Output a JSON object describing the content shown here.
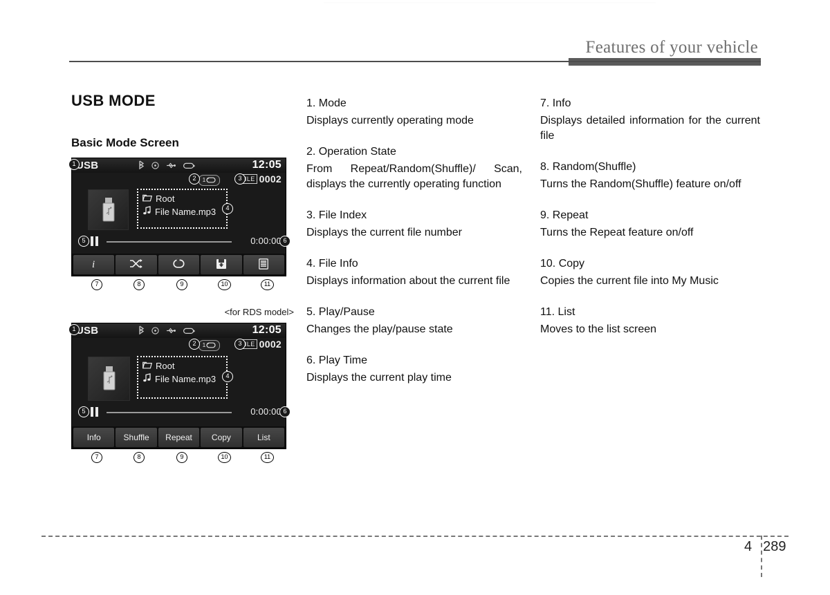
{
  "header": {
    "title": "Features of your vehicle"
  },
  "footer": {
    "chapter": "4",
    "page": "289"
  },
  "left": {
    "section_title": "USB MODE",
    "subsection_title": "Basic Mode Screen",
    "rds_caption": "<for RDS model>"
  },
  "screen": {
    "mode": "USB",
    "clock": "12:05",
    "status_icons": [
      "bluetooth-icon",
      "disc-icon",
      "usb-icon",
      "battery-icon"
    ],
    "op_state_badge": {
      "number": "1",
      "icon": "repeat-icon"
    },
    "file_index": {
      "tag": "FILE",
      "number": "0002"
    },
    "file_info": {
      "folder": "Root",
      "file": "File Name.mp3"
    },
    "play_state_icon": "pause-icon",
    "play_time": "0:00:00",
    "buttons_icons": [
      {
        "name": "info-icon",
        "glyph": "i"
      },
      {
        "name": "shuffle-icon",
        "glyph": ""
      },
      {
        "name": "repeat-icon",
        "glyph": ""
      },
      {
        "name": "copy-icon",
        "glyph": ""
      },
      {
        "name": "list-icon",
        "glyph": ""
      }
    ],
    "buttons_labels": [
      "Info",
      "Shuffle",
      "Repeat",
      "Copy",
      "List"
    ],
    "callouts": [
      "1",
      "2",
      "3",
      "4",
      "5",
      "6",
      "7",
      "8",
      "9",
      "10",
      "11"
    ]
  },
  "middle_column": [
    {
      "title": "1. Mode",
      "desc": "Displays currently operating mode"
    },
    {
      "title": "2. Operation State",
      "desc": "From Repeat/Random(Shuffle)/ Scan, displays the currently operating function"
    },
    {
      "title": "3. File Index",
      "desc": "Displays the current file number"
    },
    {
      "title": "4. File Info",
      "desc": "Displays information about the current file"
    },
    {
      "title": "5. Play/Pause",
      "desc": "Changes the play/pause state"
    },
    {
      "title": "6. Play Time",
      "desc": "Displays the current play time"
    }
  ],
  "right_column": [
    {
      "title": "7. Info",
      "desc": "Displays detailed information for the current file"
    },
    {
      "title": "8. Random(Shuffle)",
      "desc": "Turns the Random(Shuffle) feature on/off"
    },
    {
      "title": "9. Repeat",
      "desc": "Turns the Repeat feature on/off"
    },
    {
      "title": "10. Copy",
      "desc": "Copies the current file into My Music"
    },
    {
      "title": "11. List",
      "desc": "Moves to the list screen"
    }
  ]
}
